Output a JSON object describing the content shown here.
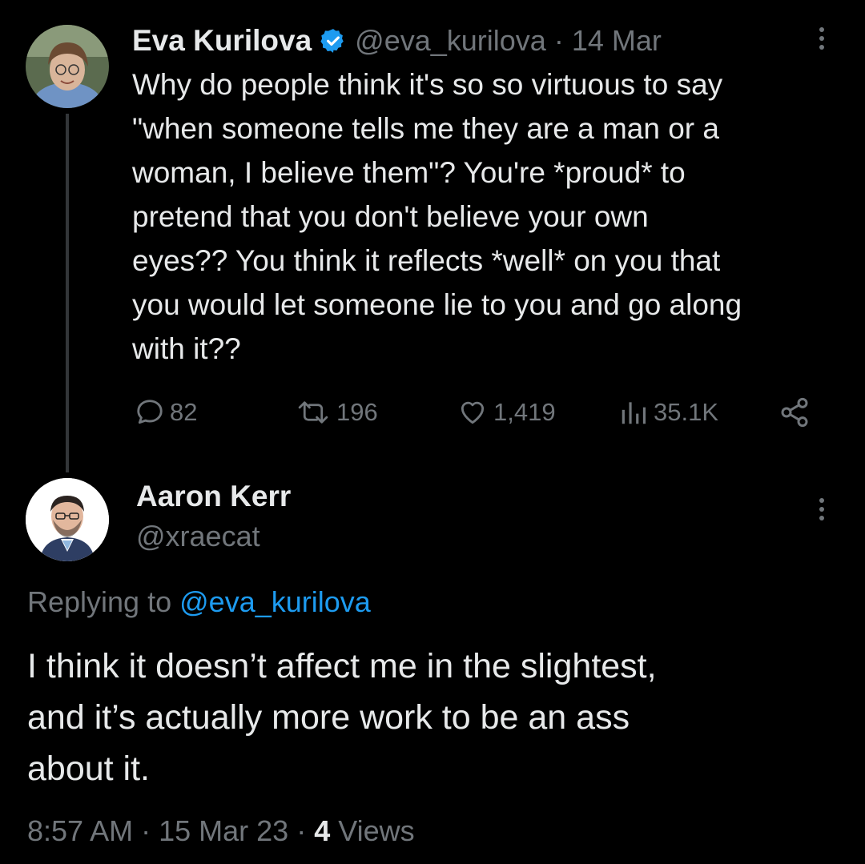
{
  "original_tweet": {
    "author_name": "Eva Kurilova",
    "handle": "@eva_kurilova",
    "separator": "·",
    "date": "14 Mar",
    "text_lines": [
      "Why do people think it's so so virtuous to say",
      "\"when someone tells me they are a man or a",
      "woman, I believe them\"? You're *proud* to",
      "pretend that you don't believe your own",
      "eyes?? You think it reflects *well* on you that",
      "you would let someone lie to you and go along",
      "with it??"
    ],
    "stats": {
      "replies": "82",
      "retweets": "196",
      "likes": "1,419",
      "views": "35.1K"
    },
    "verified_color": "#1d9bf0"
  },
  "reply_tweet": {
    "author_name": "Aaron Kerr",
    "handle": "@xraecat",
    "replying_prefix": "Replying to",
    "replying_to": "@eva_kurilova",
    "text_lines": [
      "I think it doesn’t affect me in the slightest,",
      "and it’s actually more work to be an ass",
      "about it."
    ],
    "time": "8:57 AM",
    "sep1": "·",
    "date": "15 Mar 23",
    "sep2": "·",
    "views_count": "4",
    "views_label": "Views"
  },
  "icons": {
    "reply": "speech-bubble-icon",
    "retweet": "retweet-icon",
    "like": "heart-icon",
    "views": "bar-chart-icon",
    "share": "share-icon",
    "more": "more-vertical-icon",
    "verified": "verified-badge-icon"
  },
  "colors": {
    "background": "#000000",
    "text": "#e7e9ea",
    "muted": "#71767b",
    "link": "#1d9bf0"
  }
}
